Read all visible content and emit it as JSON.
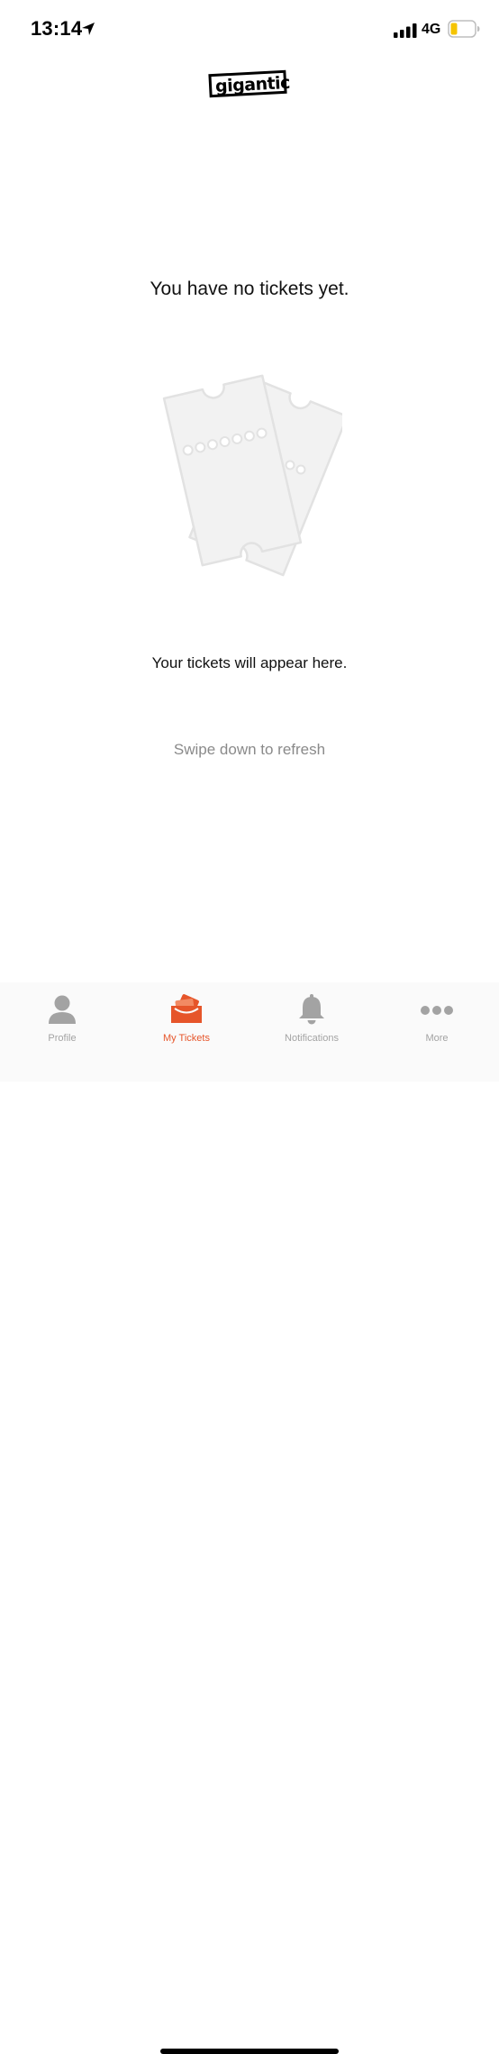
{
  "status_bar": {
    "time": "13:14",
    "network": "4G"
  },
  "logo": {
    "text": "gigantic"
  },
  "empty_state": {
    "title": "You have no tickets yet.",
    "subtitle": "Your tickets will appear here.",
    "hint": "Swipe down to refresh"
  },
  "tab_bar": {
    "items": [
      {
        "label": "Profile",
        "icon": "person-icon",
        "active": false
      },
      {
        "label": "My Tickets",
        "icon": "tickets-icon",
        "active": true
      },
      {
        "label": "Notifications",
        "icon": "bell-icon",
        "active": false
      },
      {
        "label": "More",
        "icon": "more-dots-icon",
        "active": false
      }
    ]
  },
  "colors": {
    "accent": "#e6552a",
    "inactive": "#a3a3a3",
    "battery_fill": "#f5c400",
    "illustration": "#f2f2f2"
  }
}
